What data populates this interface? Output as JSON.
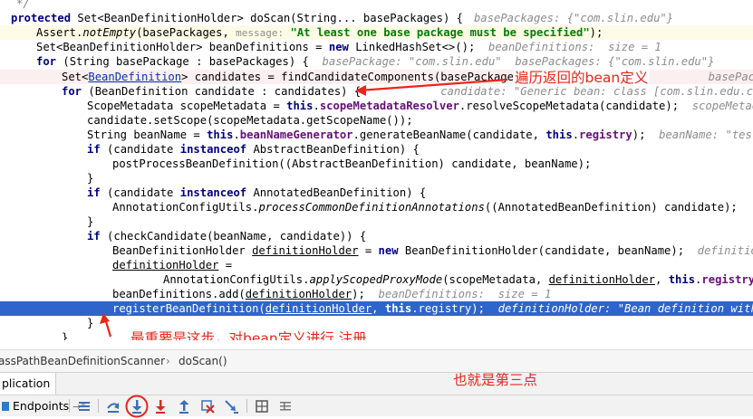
{
  "code": {
    "l0_comment": "*/",
    "l1_kw": "protected",
    "l1_a": " Set<BeanDefinitionHolder> doScan(String... basePackages) {",
    "l1_hint": "basePackages: {\"com.slin.edu\"}",
    "l2_a": "Assert.",
    "l2_method": "notEmpty",
    "l2_b": "(basePackages,",
    "l2_param": "message:",
    "l2_str": "\"At least one base package must be specified\"",
    "l2_c": ");",
    "l3_a": "Set<BeanDefinitionHolder> beanDefinitions = ",
    "l3_kw": "new",
    "l3_b": " LinkedHashSet<>();",
    "l3_hint": "beanDefinitions:  size = 1",
    "l4_kw": "for",
    "l4_a": " (String basePackage : basePackages) {",
    "l4_hint": "basePackage: \"com.slin.edu\"  basePackages: {\"com.slin.edu\"}",
    "l5_a": "Set<",
    "l5_link": "BeanDefinition",
    "l5_b": "> candidates = findCandidateComponents(basePackage);",
    "l5_hint": "basePackage: \"",
    "l6_kw": "for",
    "l6_a": " (BeanDefinition candidate : candidates) {",
    "l6_hint": "candidate: \"Generic bean: class [com.slin.edu.controller.TestCo",
    "l7_a": "ScopeMetadata scopeMetadata = ",
    "l7_kw": "this",
    "l7_dot": ".",
    "l7_fld": "scopeMetadataResolver",
    "l7_b": ".resolveScopeMetadata(candidate);",
    "l7_hint": "scopeMetadata:",
    "l8_a": "candidate.setScope(scopeMetadata.getScopeName());",
    "l9_a": "String beanName = ",
    "l9_kw": "this",
    "l9_dot": ".",
    "l9_fld": "beanNameGenerator",
    "l9_b": ".generateBeanName(candidate, ",
    "l9_kw2": "this",
    "l9_dot2": ".",
    "l9_fld2": "registry",
    "l9_c": ");",
    "l9_hint": "beanName: \"testCont",
    "l10_kw": "if",
    "l10_a": " (candidate ",
    "l10_kw2": "instanceof",
    "l10_b": " AbstractBeanDefinition) {",
    "l11_a": "postProcessBeanDefinition((AbstractBeanDefinition) candidate, beanName);",
    "l12_a": "}",
    "l13_kw": "if",
    "l13_a": " (candidate ",
    "l13_kw2": "instanceof",
    "l13_b": " AnnotatedBeanDefinition) {",
    "l14_a": "AnnotationConfigUtils.",
    "l14_method": "processCommonDefinitionAnnotations",
    "l14_b": "((AnnotatedBeanDefinition) candidate);",
    "l15_a": "}",
    "l16_kw": "if",
    "l16_a": " (checkCandidate(beanName, candidate)) {",
    "l17_a": "BeanDefinitionHolder ",
    "l17_ul": "definitionHolder",
    "l17_b": " = ",
    "l17_kw": "new",
    "l17_c": " BeanDefinitionHolder(candidate, beanName);",
    "l17_hint": "definitionHol",
    "l18_ul": "definitionHolder",
    "l18_a": " =",
    "l19_a": "AnnotationConfigUtils.",
    "l19_method": "applyScopedProxyMode",
    "l19_b": "(scopeMetadata, ",
    "l19_ul": "definitionHolder",
    "l19_c": ", ",
    "l19_kw": "this",
    "l19_dot": ".",
    "l19_fld": "registry",
    "l19_d": ");",
    "l20_a": "beanDefinitions.add(",
    "l20_ul": "definitionHolder",
    "l20_b": ");",
    "l20_hint": "beanDefinitions:  size = 1",
    "l21_a": "registerBeanDefinition(",
    "l21_ul": "definitionHolder",
    "l21_b": ", ",
    "l21_kw": "this",
    "l21_c": ".registry);",
    "l21_hint": "definitionHolder: \"Bean definition with nam",
    "l22_a": "}",
    "l23_a": "}"
  },
  "annotations": {
    "traverse": "遍历返回的bean定义",
    "important": "最重要是这步，对bean定义进行 注册",
    "third": "也就是第三点"
  },
  "breadcrumb": {
    "class_name": "assPathBeanDefinitionScanner",
    "separator": "›",
    "method_name": "doScan()"
  },
  "debug": {
    "tab_label": "plication",
    "endpoints_label": "Endpoints",
    "endpoints_suffix": "→\""
  },
  "icons": [
    "arrow-left-annotation-icon",
    "arrow-up-annotation-icon",
    "console-lines-icon",
    "step-over-icon",
    "step-into-icon",
    "force-step-into-icon",
    "step-out-icon",
    "drop-frame-icon",
    "run-to-cursor-icon",
    "evaluate-icon",
    "table-icon"
  ],
  "colors": {
    "selection": "#2f65ca",
    "annotation_red": "#e8261b",
    "keyword": "#000080",
    "string": "#008000",
    "field": "#660e7a"
  }
}
